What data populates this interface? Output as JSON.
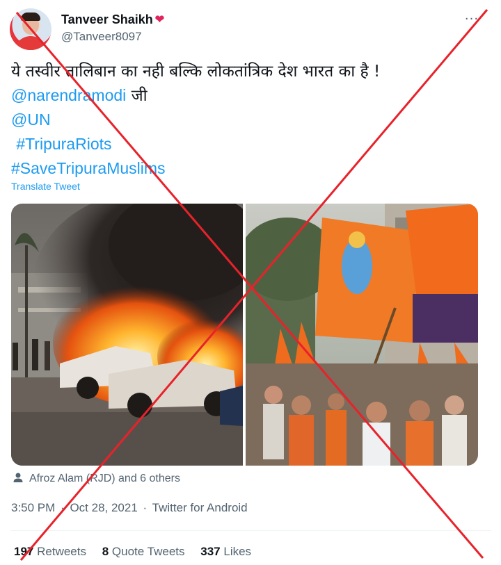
{
  "author": {
    "display_name": "Tanveer Shaikh",
    "name_emoji": "❤",
    "handle": "@Tanveer8097",
    "avatar_icon": "profile-photo"
  },
  "menu": {
    "more_label": "···"
  },
  "tweet": {
    "text_line_1": "ये तस्वीर तालिबान का नही बल्कि लोकतांत्रिक देश भारत का है !",
    "mention_1": "@narendramodi",
    "mention_1_suffix": " जी",
    "mention_2": "@UN",
    "hashtag_1": "#TripuraRiots",
    "hashtag_2": "#SaveTripuraMuslims",
    "translate_label": "Translate Tweet"
  },
  "social_context": {
    "icon": "person-icon",
    "text": "Afroz Alam (RJD) and 6 others"
  },
  "meta": {
    "time": "3:50 PM",
    "separator": "·",
    "date": "Oct 28, 2021",
    "source": "Twitter for Android"
  },
  "stats": {
    "retweets_count": "197",
    "retweets_label": "Retweets",
    "quotes_count": "8",
    "quotes_label": "Quote Tweets",
    "likes_count": "337",
    "likes_label": "Likes"
  },
  "colors": {
    "link": "#1d9bf0",
    "secondary_text": "#536471",
    "primary_text": "#0f1419",
    "cross": "#e8222a"
  }
}
